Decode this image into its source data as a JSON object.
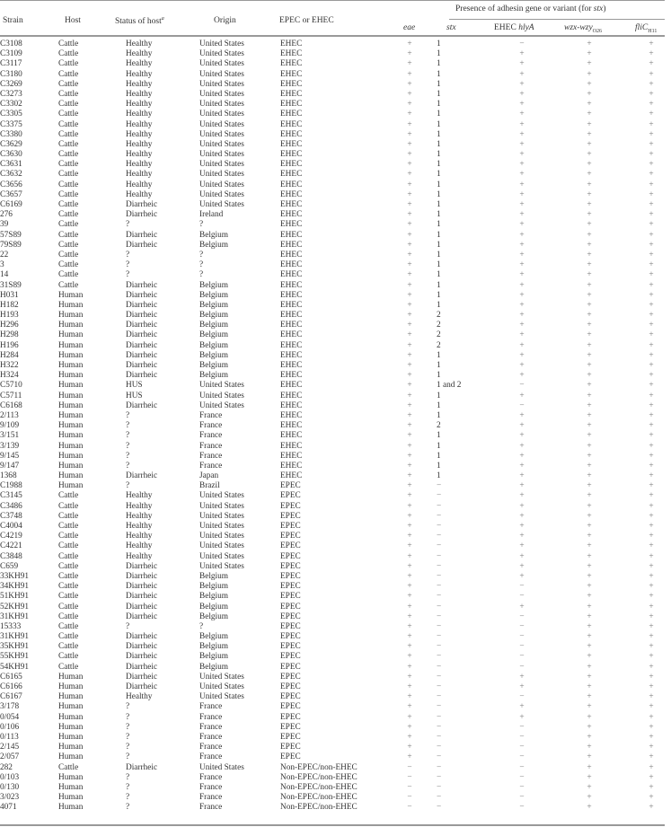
{
  "table": {
    "headers": {
      "strain": "Strain",
      "host": "Host",
      "status": "Status of host",
      "status_footnote": "a",
      "origin": "Origin",
      "type": "EPEC or EHEC",
      "group": "Presence of adhesin gene or variant (for ",
      "group_italic": "stx",
      "group_end": ")",
      "eae": "eae",
      "stx": "stx",
      "hly_prefix": "EHEC ",
      "hly_italic": "hlyA",
      "wzx": "wzx-wzy",
      "wzx_sub": "O26",
      "fli": "fliC",
      "fli_sub": "H11"
    },
    "rows": [
      [
        "C3108",
        "Cattle",
        "Healthy",
        "United States",
        "EHEC",
        "+",
        "1",
        "−",
        "+",
        "+"
      ],
      [
        "C3109",
        "Cattle",
        "Healthy",
        "United States",
        "EHEC",
        "+",
        "1",
        "+",
        "+",
        "+"
      ],
      [
        "C3117",
        "Cattle",
        "Healthy",
        "United States",
        "EHEC",
        "+",
        "1",
        "+",
        "+",
        "+"
      ],
      [
        "C3180",
        "Cattle",
        "Healthy",
        "United States",
        "EHEC",
        "+",
        "1",
        "+",
        "+",
        "+"
      ],
      [
        "C3269",
        "Cattle",
        "Healthy",
        "United States",
        "EHEC",
        "+",
        "1",
        "+",
        "+",
        "+"
      ],
      [
        "C3273",
        "Cattle",
        "Healthy",
        "United States",
        "EHEC",
        "+",
        "1",
        "+",
        "+",
        "+"
      ],
      [
        "C3302",
        "Cattle",
        "Healthy",
        "United States",
        "EHEC",
        "+",
        "1",
        "+",
        "+",
        "+"
      ],
      [
        "C3305",
        "Cattle",
        "Healthy",
        "United States",
        "EHEC",
        "+",
        "1",
        "+",
        "+",
        "+"
      ],
      [
        "C3375",
        "Cattle",
        "Healthy",
        "United States",
        "EHEC",
        "+",
        "1",
        "+",
        "+",
        "+"
      ],
      [
        "C3380",
        "Cattle",
        "Healthy",
        "United States",
        "EHEC",
        "+",
        "1",
        "+",
        "+",
        "+"
      ],
      [
        "C3629",
        "Cattle",
        "Healthy",
        "United States",
        "EHEC",
        "+",
        "1",
        "+",
        "+",
        "+"
      ],
      [
        "C3630",
        "Cattle",
        "Healthy",
        "United States",
        "EHEC",
        "+",
        "1",
        "+",
        "+",
        "+"
      ],
      [
        "C3631",
        "Cattle",
        "Healthy",
        "United States",
        "EHEC",
        "+",
        "1",
        "+",
        "+",
        "+"
      ],
      [
        "C3632",
        "Cattle",
        "Healthy",
        "United States",
        "EHEC",
        "+",
        "1",
        "+",
        "+",
        "+"
      ],
      [
        "C3656",
        "Cattle",
        "Healthy",
        "United States",
        "EHEC",
        "+",
        "1",
        "+",
        "+",
        "+"
      ],
      [
        "C3657",
        "Cattle",
        "Healthy",
        "United States",
        "EHEC",
        "+",
        "1",
        "+",
        "+",
        "+"
      ],
      [
        "C6169",
        "Cattle",
        "Diarrheic",
        "United States",
        "EHEC",
        "+",
        "1",
        "+",
        "+",
        "+"
      ],
      [
        "276",
        "Cattle",
        "Diarrheic",
        "Ireland",
        "EHEC",
        "+",
        "1",
        "+",
        "+",
        "+"
      ],
      [
        "39",
        "Cattle",
        "?",
        "?",
        "EHEC",
        "+",
        "1",
        "+",
        "+",
        "+"
      ],
      [
        "57S89",
        "Cattle",
        "Diarrheic",
        "Belgium",
        "EHEC",
        "+",
        "1",
        "+",
        "+",
        "+"
      ],
      [
        "79S89",
        "Cattle",
        "Diarrheic",
        "Belgium",
        "EHEC",
        "+",
        "1",
        "+",
        "+",
        "+"
      ],
      [
        "22",
        "Cattle",
        "?",
        "?",
        "EHEC",
        "+",
        "1",
        "+",
        "+",
        "+"
      ],
      [
        "3",
        "Cattle",
        "?",
        "?",
        "EHEC",
        "+",
        "1",
        "+",
        "+",
        "+"
      ],
      [
        "14",
        "Cattle",
        "?",
        "?",
        "EHEC",
        "+",
        "1",
        "+",
        "+",
        "+"
      ],
      [
        "31S89",
        "Cattle",
        "Diarrheic",
        "Belgium",
        "EHEC",
        "+",
        "1",
        "+",
        "+",
        "+"
      ],
      [
        "H031",
        "Human",
        "Diarrheic",
        "Belgium",
        "EHEC",
        "+",
        "1",
        "+",
        "+",
        "+"
      ],
      [
        "H182",
        "Human",
        "Diarrheic",
        "Belgium",
        "EHEC",
        "+",
        "1",
        "+",
        "+",
        "+"
      ],
      [
        "H193",
        "Human",
        "Diarrheic",
        "Belgium",
        "EHEC",
        "+",
        "2",
        "+",
        "+",
        "+"
      ],
      [
        "H296",
        "Human",
        "Diarrheic",
        "Belgium",
        "EHEC",
        "+",
        "2",
        "+",
        "+",
        "+"
      ],
      [
        "H298",
        "Human",
        "Diarrheic",
        "Belgium",
        "EHEC",
        "+",
        "2",
        "+",
        "+",
        "+"
      ],
      [
        "H196",
        "Human",
        "Diarrheic",
        "Belgium",
        "EHEC",
        "+",
        "2",
        "+",
        "+",
        "+"
      ],
      [
        "H284",
        "Human",
        "Diarrheic",
        "Belgium",
        "EHEC",
        "+",
        "1",
        "+",
        "+",
        "+"
      ],
      [
        "H322",
        "Human",
        "Diarrheic",
        "Belgium",
        "EHEC",
        "+",
        "1",
        "+",
        "+",
        "+"
      ],
      [
        "H324",
        "Human",
        "Diarrheic",
        "Belgium",
        "EHEC",
        "+",
        "1",
        "+",
        "+",
        "+"
      ],
      [
        "C5710",
        "Human",
        "HUS",
        "United States",
        "EHEC",
        "+",
        "1 and 2",
        "−",
        "+",
        "+"
      ],
      [
        "C5711",
        "Human",
        "HUS",
        "United States",
        "EHEC",
        "+",
        "1",
        "+",
        "+",
        "+"
      ],
      [
        "C6168",
        "Human",
        "Diarrheic",
        "United States",
        "EHEC",
        "+",
        "1",
        "−",
        "+",
        "+"
      ],
      [
        "2/113",
        "Human",
        "?",
        "France",
        "EHEC",
        "+",
        "1",
        "+",
        "+",
        "+"
      ],
      [
        "9/109",
        "Human",
        "?",
        "France",
        "EHEC",
        "+",
        "2",
        "+",
        "+",
        "+"
      ],
      [
        "3/151",
        "Human",
        "?",
        "France",
        "EHEC",
        "+",
        "1",
        "+",
        "+",
        "+"
      ],
      [
        "3/139",
        "Human",
        "?",
        "France",
        "EHEC",
        "+",
        "1",
        "+",
        "+",
        "+"
      ],
      [
        "9/145",
        "Human",
        "?",
        "France",
        "EHEC",
        "+",
        "1",
        "+",
        "+",
        "+"
      ],
      [
        "9/147",
        "Human",
        "?",
        "France",
        "EHEC",
        "+",
        "1",
        "+",
        "+",
        "+"
      ],
      [
        "1368",
        "Human",
        "Diarrheic",
        "Japan",
        "EHEC",
        "+",
        "1",
        "+",
        "+",
        "+"
      ],
      [
        "C1988",
        "Human",
        "?",
        "Brazil",
        "EPEC",
        "+",
        "−",
        "+",
        "+",
        "+"
      ],
      [
        "C3145",
        "Cattle",
        "Healthy",
        "United States",
        "EPEC",
        "+",
        "−",
        "+",
        "+",
        "+"
      ],
      [
        "C3486",
        "Cattle",
        "Healthy",
        "United States",
        "EPEC",
        "+",
        "−",
        "+",
        "+",
        "+"
      ],
      [
        "C3748",
        "Cattle",
        "Healthy",
        "United States",
        "EPEC",
        "+",
        "−",
        "+",
        "+",
        "+"
      ],
      [
        "C4004",
        "Cattle",
        "Healthy",
        "United States",
        "EPEC",
        "+",
        "−",
        "+",
        "+",
        "+"
      ],
      [
        "C4219",
        "Cattle",
        "Healthy",
        "United States",
        "EPEC",
        "+",
        "−",
        "+",
        "+",
        "+"
      ],
      [
        "C4221",
        "Cattle",
        "Healthy",
        "United States",
        "EPEC",
        "+",
        "−",
        "+",
        "+",
        "+"
      ],
      [
        "C3848",
        "Cattle",
        "Healthy",
        "United States",
        "EPEC",
        "+",
        "−",
        "+",
        "+",
        "+"
      ],
      [
        "C659",
        "Cattle",
        "Diarrheic",
        "United States",
        "EPEC",
        "+",
        "−",
        "+",
        "+",
        "+"
      ],
      [
        "33KH91",
        "Cattle",
        "Diarrheic",
        "Belgium",
        "EPEC",
        "+",
        "−",
        "+",
        "+",
        "+"
      ],
      [
        "34KH91",
        "Cattle",
        "Diarrheic",
        "Belgium",
        "EPEC",
        "+",
        "−",
        "−",
        "+",
        "+"
      ],
      [
        "51KH91",
        "Cattle",
        "Diarrheic",
        "Belgium",
        "EPEC",
        "+",
        "−",
        "−",
        "+",
        "+"
      ],
      [
        "52KH91",
        "Cattle",
        "Diarrheic",
        "Belgium",
        "EPEC",
        "+",
        "−",
        "+",
        "+",
        "+"
      ],
      [
        "31KH91",
        "Cattle",
        "Diarrheic",
        "Belgium",
        "EPEC",
        "+",
        "−",
        "−",
        "+",
        "+"
      ],
      [
        "15333",
        "Cattle",
        "?",
        "?",
        "EPEC",
        "+",
        "−",
        "−",
        "+",
        "+"
      ],
      [
        "31KH91",
        "Cattle",
        "Diarrheic",
        "Belgium",
        "EPEC",
        "+",
        "−",
        "−",
        "+",
        "+"
      ],
      [
        "35KH91",
        "Cattle",
        "Diarrheic",
        "Belgium",
        "EPEC",
        "+",
        "−",
        "−",
        "+",
        "+"
      ],
      [
        "55KH91",
        "Cattle",
        "Diarrheic",
        "Belgium",
        "EPEC",
        "+",
        "−",
        "−",
        "+",
        "+"
      ],
      [
        "54KH91",
        "Cattle",
        "Diarrheic",
        "Belgium",
        "EPEC",
        "+",
        "−",
        "−",
        "+",
        "+"
      ],
      [
        "C6165",
        "Human",
        "Diarrheic",
        "United States",
        "EPEC",
        "+",
        "−",
        "+",
        "+",
        "+"
      ],
      [
        "C6166",
        "Human",
        "Diarrheic",
        "United States",
        "EPEC",
        "+",
        "−",
        "+",
        "+",
        "+"
      ],
      [
        "C6167",
        "Human",
        "Healthy",
        "United States",
        "EPEC",
        "+",
        "−",
        "−",
        "+",
        "+"
      ],
      [
        "3/178",
        "Human",
        "?",
        "France",
        "EPEC",
        "+",
        "−",
        "+",
        "+",
        "+"
      ],
      [
        "0/054",
        "Human",
        "?",
        "France",
        "EPEC",
        "+",
        "−",
        "+",
        "+",
        "+"
      ],
      [
        "0/106",
        "Human",
        "?",
        "France",
        "EPEC",
        "+",
        "−",
        "−",
        "+",
        "+"
      ],
      [
        "0/113",
        "Human",
        "?",
        "France",
        "EPEC",
        "+",
        "−",
        "−",
        "+",
        "+"
      ],
      [
        "2/145",
        "Human",
        "?",
        "France",
        "EPEC",
        "+",
        "−",
        "−",
        "+",
        "+"
      ],
      [
        "2/057",
        "Human",
        "?",
        "France",
        "EPEC",
        "+",
        "−",
        "−",
        "+",
        "+"
      ],
      [
        "282",
        "Cattle",
        "Diarrheic",
        "United States",
        "Non-EPEC/non-EHEC",
        "−",
        "−",
        "−",
        "+",
        "+"
      ],
      [
        "0/103",
        "Human",
        "?",
        "France",
        "Non-EPEC/non-EHEC",
        "−",
        "−",
        "−",
        "+",
        "+"
      ],
      [
        "0/130",
        "Human",
        "?",
        "France",
        "Non-EPEC/non-EHEC",
        "−",
        "−",
        "−",
        "+",
        "+"
      ],
      [
        "3/023",
        "Human",
        "?",
        "France",
        "Non-EPEC/non-EHEC",
        "−",
        "−",
        "−",
        "+",
        "+"
      ],
      [
        "4071",
        "Human",
        "?",
        "France",
        "Non-EPEC/non-EHEC",
        "−",
        "−",
        "−",
        "+",
        "+"
      ]
    ]
  }
}
